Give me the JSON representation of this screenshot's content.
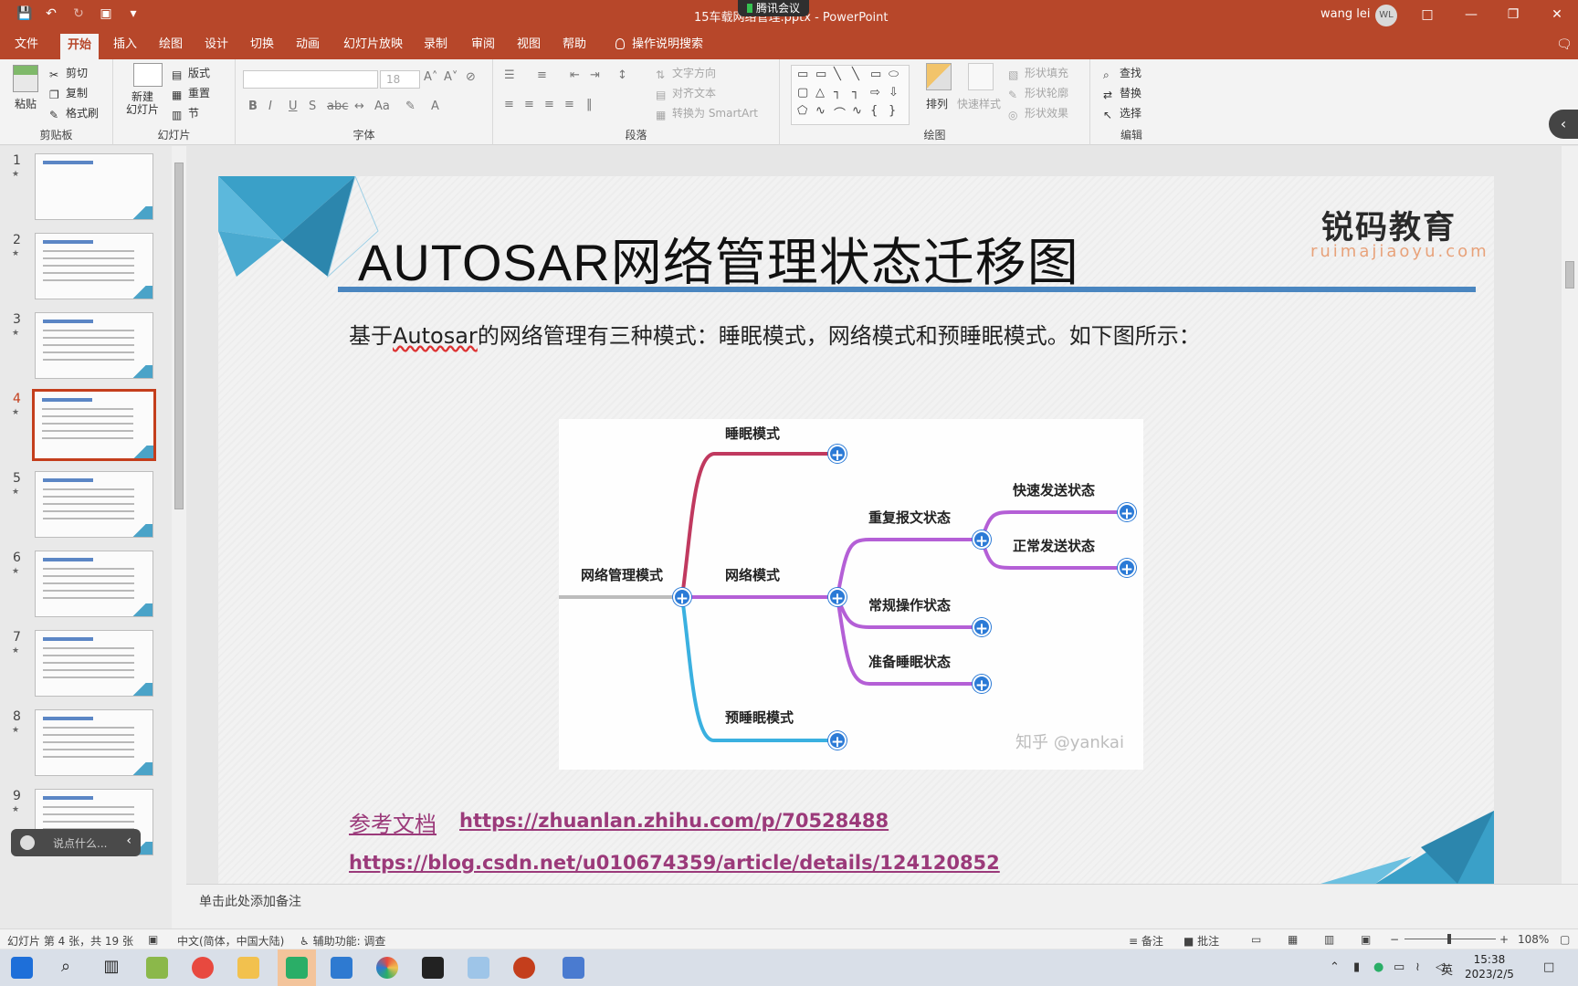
{
  "window": {
    "doc_title": "15车载网络管理.pptx - PowerPoint",
    "meeting_badge": "腾讯会议",
    "user_name": "wang lei",
    "user_initials": "WL"
  },
  "menu": {
    "tabs": [
      "文件",
      "开始",
      "插入",
      "绘图",
      "设计",
      "切换",
      "动画",
      "幻灯片放映",
      "录制",
      "审阅",
      "视图",
      "帮助"
    ],
    "active_tab": "开始",
    "search": "操作说明搜索"
  },
  "ribbon": {
    "clipboard": {
      "paste": "粘贴",
      "cut": "剪切",
      "copy": "复制",
      "format_painter": "格式刷",
      "label": "剪贴板"
    },
    "slides": {
      "new_slide": "新建\n幻灯片",
      "layout": "版式",
      "reset": "重置",
      "section": "节",
      "label": "幻灯片"
    },
    "font": {
      "size": "18",
      "label": "字体"
    },
    "paragraph": {
      "text_direction": "文字方向",
      "align_text": "对齐文本",
      "smartart": "转换为 SmartArt",
      "label": "段落"
    },
    "drawing": {
      "arrange": "排列",
      "quick_styles": "快速样式",
      "shape_fill": "形状填充",
      "shape_outline": "形状轮廓",
      "shape_effects": "形状效果",
      "label": "绘图"
    },
    "editing": {
      "find": "查找",
      "replace": "替换",
      "select": "选择",
      "label": "编辑"
    }
  },
  "thumbnails": [
    {
      "num": "1"
    },
    {
      "num": "2"
    },
    {
      "num": "3"
    },
    {
      "num": "4"
    },
    {
      "num": "5"
    },
    {
      "num": "6"
    },
    {
      "num": "7"
    },
    {
      "num": "8"
    },
    {
      "num": "9"
    }
  ],
  "selected_slide": "4",
  "chat_placeholder": "说点什么...",
  "slide": {
    "title": "AUTOSAR网络管理状态迁移图",
    "brand_cn": "锐码教育",
    "brand_en": "ruimajiaoyu.com",
    "intro_prefix": "基于",
    "intro_word": "Autosar",
    "intro_suffix": "的网络管理有三种模式：睡眠模式，网络模式和预睡眠模式。如下图所示：",
    "mindmap": {
      "root": "网络管理模式",
      "sleep": "睡眠模式",
      "network": "网络模式",
      "presleep": "预睡眠模式",
      "repeat_msg": "重复报文状态",
      "normal_op": "常规操作状态",
      "ready_sleep": "准备睡眠状态",
      "fast_send": "快速发送状态",
      "normal_send": "正常发送状态",
      "watermark": "知乎 @yankai"
    },
    "ref_label": "参考文档",
    "ref_link1": "https://zhuanlan.zhihu.com/p/70528488",
    "ref_link2": "https://blog.csdn.net/u010674359/article/details/124120852"
  },
  "notes_placeholder": "单击此处添加备注",
  "status": {
    "slide_info": "幻灯片 第 4 张，共 19 张",
    "language": "中文(简体，中国大陆)",
    "accessibility": "辅助功能: 调查",
    "notes": "备注",
    "comments": "批注",
    "zoom": "108%",
    "zoom_fraction": 0.47
  },
  "taskbar": {
    "time": "15:38",
    "date": "2023/2/5",
    "ime": "英"
  },
  "colors": {
    "accent": "#b7472a",
    "sleep_branch": "#c0395f",
    "network_branch": "#b45fd6",
    "presleep_branch": "#3ab0e0",
    "link": "#9b3a7a"
  }
}
